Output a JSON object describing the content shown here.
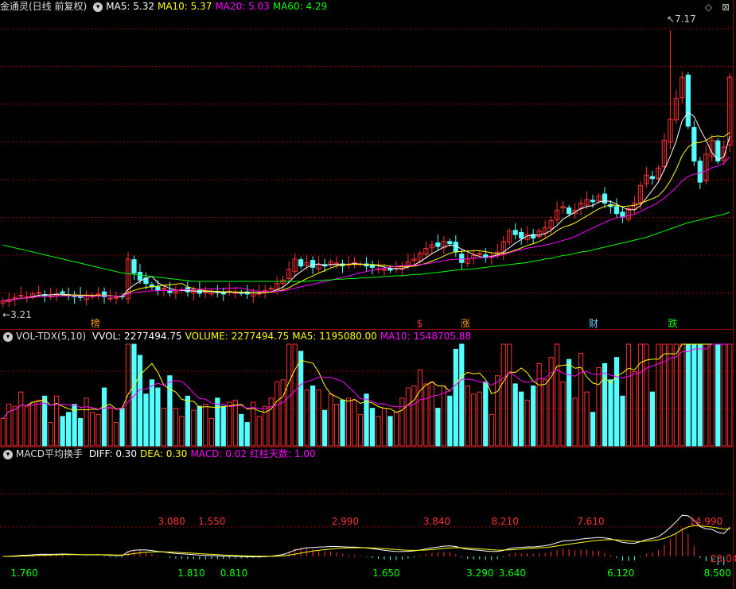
{
  "price": {
    "title": "金通灵(日线 前复权)",
    "ma_items": [
      {
        "label": "MA5:",
        "value": "5.32",
        "color": "#ffffff"
      },
      {
        "label": "MA10:",
        "value": "5.37",
        "color": "#ffff00"
      },
      {
        "label": "MA20:",
        "value": "5.03",
        "color": "#ff00ff"
      },
      {
        "label": "MA60:",
        "value": "4.29",
        "color": "#00ff00"
      }
    ],
    "high_label": "7.17",
    "low_label": "3.21",
    "markers": [
      {
        "text": "榜",
        "color": "#ff9900",
        "pos": 0.13
      },
      {
        "text": "$",
        "color": "#ff3333",
        "pos": 0.575
      },
      {
        "text": "涨",
        "color": "#ff9900",
        "pos": 0.635
      },
      {
        "text": "财",
        "color": "#66ccff",
        "pos": 0.81
      },
      {
        "text": "跌",
        "color": "#00ff00",
        "pos": 0.918
      }
    ],
    "icons": [
      "diamond-icon",
      "close-icon"
    ]
  },
  "volume": {
    "title": "VOL-TDX(5,10)",
    "items": [
      {
        "label": "VVOL:",
        "value": "2277494.75",
        "color": "#ffffff"
      },
      {
        "label": "VOLUME:",
        "value": "2277494.75",
        "color": "#ffff00"
      },
      {
        "label": "MA5:",
        "value": "1195080.00",
        "color": "#ffff00"
      },
      {
        "label": "MA10:",
        "value": "1548705.88",
        "color": "#ff00ff"
      }
    ]
  },
  "macd": {
    "title": "MACD平均换手",
    "items": [
      {
        "label": "DIFF:",
        "value": "0.30",
        "color": "#ffffff"
      },
      {
        "label": "DEA:",
        "value": "0.30",
        "color": "#ffff00"
      },
      {
        "label": "MACD:",
        "value": "0.02",
        "color": "#ff00ff"
      },
      {
        "label": "红柱天数:",
        "value": "1.00",
        "color": "#ff00ff"
      }
    ],
    "red_labels": [
      {
        "text": "3.080",
        "pos": 0.235
      },
      {
        "text": "1.550",
        "pos": 0.29
      },
      {
        "text": "2.990",
        "pos": 0.472
      },
      {
        "text": "3.840",
        "pos": 0.597
      },
      {
        "text": "8.210",
        "pos": 0.69
      },
      {
        "text": "7.610",
        "pos": 0.807
      },
      {
        "text": "14.990",
        "pos": 0.96
      }
    ],
    "green_labels": [
      {
        "text": "1.760",
        "pos": 0.034
      },
      {
        "text": "1.810",
        "pos": 0.262
      },
      {
        "text": "0.810",
        "pos": 0.32
      },
      {
        "text": "1.650",
        "pos": 0.528
      },
      {
        "text": "3.290",
        "pos": 0.656
      },
      {
        "text": "3.640",
        "pos": 0.7
      },
      {
        "text": "6.120",
        "pos": 0.848
      },
      {
        "text": "8.500",
        "pos": 0.98
      }
    ],
    "right_label": "23.04"
  },
  "colors": {
    "up": "#ff3030",
    "down": "#54ffff",
    "grid": "#8b0000"
  },
  "chart_data": {
    "type": "candlestick",
    "price_range": [
      3.0,
      7.4
    ],
    "close": [
      3.3,
      3.32,
      3.35,
      3.38,
      3.36,
      3.4,
      3.42,
      3.38,
      3.37,
      3.4,
      3.41,
      3.38,
      3.36,
      3.35,
      3.37,
      3.38,
      3.4,
      3.36,
      3.34,
      3.35,
      3.36,
      3.9,
      3.7,
      3.6,
      3.55,
      3.5,
      3.45,
      3.48,
      3.42,
      3.44,
      3.46,
      3.43,
      3.45,
      3.41,
      3.43,
      3.44,
      3.42,
      3.4,
      3.44,
      3.42,
      3.41,
      3.4,
      3.42,
      3.41,
      3.45,
      3.48,
      3.55,
      3.6,
      3.75,
      3.9,
      3.8,
      3.85,
      3.78,
      3.82,
      3.8,
      3.86,
      3.84,
      3.8,
      3.82,
      3.85,
      3.83,
      3.8,
      3.78,
      3.76,
      3.75,
      3.74,
      3.77,
      3.8,
      3.86,
      3.9,
      3.98,
      4.05,
      4.1,
      4.08,
      4.15,
      4.12,
      4.0,
      3.85,
      3.9,
      3.95,
      3.98,
      3.92,
      3.94,
      4.0,
      4.15,
      4.3,
      4.25,
      4.2,
      4.25,
      4.2,
      4.3,
      4.35,
      4.45,
      4.6,
      4.65,
      4.55,
      4.6,
      4.7,
      4.75,
      4.72,
      4.8,
      4.7,
      4.65,
      4.55,
      4.5,
      4.62,
      4.7,
      4.95,
      5.1,
      5.05,
      5.2,
      5.6,
      5.9,
      6.2,
      6.5,
      5.8,
      5.3,
      5.0,
      5.4,
      5.6,
      5.3,
      5.5,
      6.5
    ],
    "ma60": [
      4.1,
      4.08,
      4.06,
      4.04,
      4.02,
      4.0,
      3.98,
      3.96,
      3.94,
      3.92,
      3.9,
      3.88,
      3.86,
      3.84,
      3.82,
      3.8,
      3.78,
      3.76,
      3.74,
      3.72,
      3.7,
      3.69,
      3.68,
      3.67,
      3.66,
      3.65,
      3.64,
      3.63,
      3.62,
      3.61,
      3.6,
      3.59,
      3.58,
      3.58,
      3.58,
      3.58,
      3.58,
      3.58,
      3.58,
      3.58,
      3.58,
      3.58,
      3.58,
      3.58,
      3.58,
      3.58,
      3.58,
      3.58,
      3.58,
      3.58,
      3.58,
      3.58,
      3.59,
      3.59,
      3.6,
      3.6,
      3.61,
      3.61,
      3.62,
      3.62,
      3.63,
      3.63,
      3.64,
      3.64,
      3.65,
      3.65,
      3.66,
      3.66,
      3.67,
      3.68,
      3.68,
      3.69,
      3.7,
      3.71,
      3.72,
      3.73,
      3.74,
      3.75,
      3.75,
      3.76,
      3.77,
      3.78,
      3.79,
      3.8,
      3.81,
      3.82,
      3.83,
      3.84,
      3.85,
      3.87,
      3.88,
      3.9,
      3.91,
      3.93,
      3.95,
      3.96,
      3.98,
      4.0,
      4.01,
      4.03,
      4.05,
      4.07,
      4.09,
      4.11,
      4.13,
      4.15,
      4.17,
      4.19,
      4.21,
      4.24,
      4.27,
      4.3,
      4.33,
      4.36,
      4.39,
      4.42,
      4.44,
      4.46,
      4.48,
      4.5,
      4.52,
      4.54,
      4.57
    ]
  }
}
